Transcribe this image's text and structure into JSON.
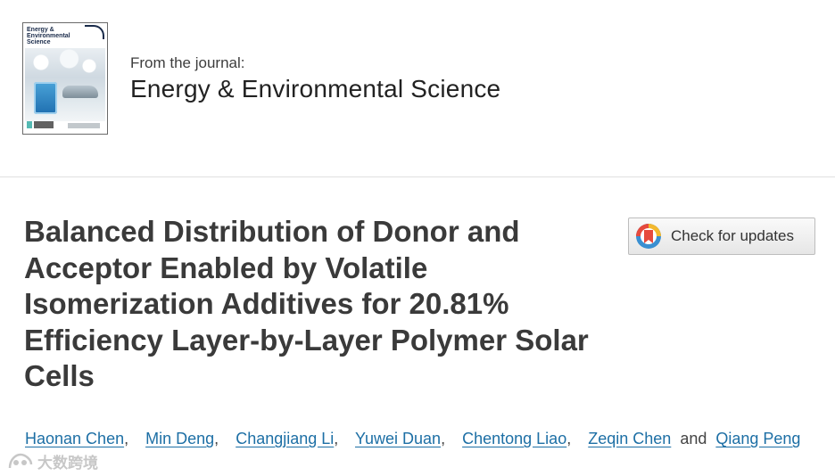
{
  "journal": {
    "cover_title": "Energy & Environmental Science",
    "from_label": "From the journal:",
    "name": "Energy & Environmental Science"
  },
  "article": {
    "title": "Balanced Distribution of Donor and Acceptor Enabled by Volatile Isomerization Additives for 20.81% Efficiency Layer-by-Layer Polymer Solar Cells"
  },
  "check_updates": {
    "label": "Check for updates",
    "icon": "crossmark-icon"
  },
  "authors": {
    "list": [
      "Haonan Chen",
      "Min Deng",
      "Changjiang Li",
      "Yuwei Duan",
      "Chentong Liao",
      "Zeqin Chen",
      "Qiang Peng"
    ],
    "separator": ",",
    "conjunction": "and"
  },
  "watermark": {
    "text": "大数跨境"
  },
  "colors": {
    "link": "#1d6fa5",
    "title": "#3a3a3a",
    "crossmark_red": "#e64a3d",
    "crossmark_yellow": "#f3b82e",
    "crossmark_blue": "#3a8fd1"
  }
}
